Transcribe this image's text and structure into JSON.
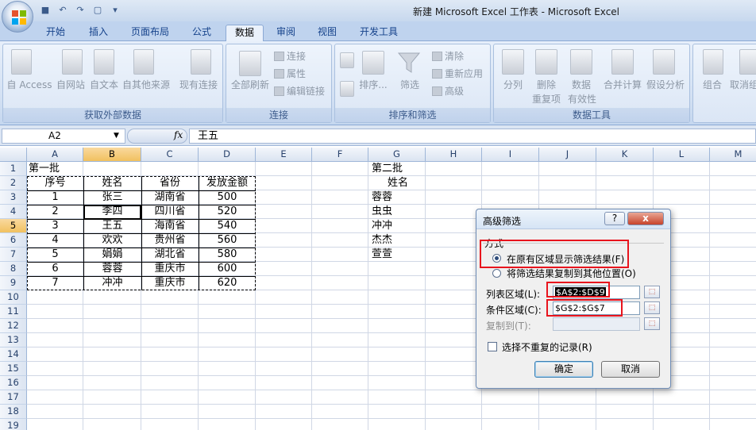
{
  "window": {
    "title": "新建 Microsoft Excel 工作表 - Microsoft Excel"
  },
  "tabs": [
    "开始",
    "插入",
    "页面布局",
    "公式",
    "数据",
    "审阅",
    "视图",
    "开发工具"
  ],
  "active_tab": "数据",
  "ribbon": {
    "external": {
      "caption": "获取外部数据",
      "buttons": [
        "自 Access",
        "自网站",
        "自文本",
        "自其他来源",
        "现有连接"
      ]
    },
    "connections": {
      "caption": "连接",
      "refresh": "全部刷新",
      "small": [
        "连接",
        "属性",
        "编辑链接"
      ]
    },
    "sort_filter": {
      "caption": "排序和筛选",
      "sort": "排序...",
      "filter": "筛选",
      "small": [
        "清除",
        "重新应用",
        "高级"
      ]
    },
    "data_tools": {
      "caption": "数据工具",
      "split": "分列",
      "remove_dup_1": "删除",
      "remove_dup_2": "重复项",
      "validation_1": "数据",
      "validation_2": "有效性",
      "consolidate": "合并计算",
      "whatif": "假设分析"
    },
    "outline": {
      "group": "组合",
      "ungroup": "取消组"
    }
  },
  "formula_bar": {
    "name_box": "A2",
    "fx": "fx",
    "formula": "王五"
  },
  "grid": {
    "columns": [
      "A",
      "B",
      "C",
      "D",
      "E",
      "F",
      "G",
      "H",
      "I",
      "J",
      "K",
      "L",
      "M"
    ],
    "rows": [
      "1",
      "2",
      "3",
      "4",
      "5",
      "6",
      "7",
      "8",
      "9",
      "10",
      "11",
      "12",
      "13",
      "14",
      "15",
      "16",
      "17",
      "18",
      "19"
    ],
    "batch1_label": "第一批",
    "headers": [
      "序号",
      "姓名",
      "省份",
      "发放金额"
    ],
    "table": [
      [
        "1",
        "张三",
        "湖南省",
        "500"
      ],
      [
        "2",
        "李四",
        "四川省",
        "520"
      ],
      [
        "3",
        "王五",
        "海南省",
        "540"
      ],
      [
        "4",
        "欢欢",
        "贵州省",
        "560"
      ],
      [
        "5",
        "娟娟",
        "湖北省",
        "580"
      ],
      [
        "6",
        "蓉蓉",
        "重庆市",
        "600"
      ],
      [
        "7",
        "冲冲",
        "重庆市",
        "620"
      ]
    ],
    "batch2_label": "第二批",
    "criteria_header": "姓名",
    "criteria": [
      "蓉蓉",
      "虫虫",
      "冲冲",
      "杰杰",
      "萱萱"
    ]
  },
  "dialog": {
    "title": "高级筛选",
    "help": "?",
    "close": "x",
    "section": "方式",
    "option1": "在原有区域显示筛选结果(F)",
    "option2": "将筛选结果复制到其他位置(O)",
    "list_label": "列表区域(L):",
    "list_value": "$A$2:$D$9",
    "criteria_label": "条件区域(C):",
    "criteria_value": "$G$2:$G$7",
    "copyto_label": "复制到(T):",
    "copyto_value": "",
    "unique_label": "选择不重复的记录(R)",
    "ok": "确定",
    "cancel": "取消"
  }
}
